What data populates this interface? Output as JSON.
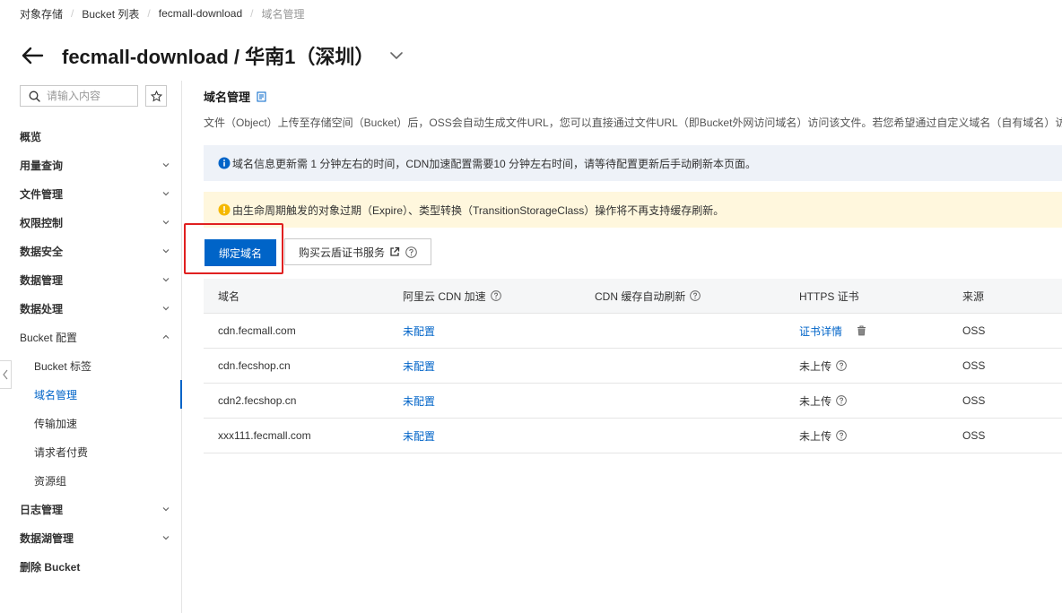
{
  "breadcrumb": [
    "对象存储",
    "Bucket 列表",
    "fecmall-download",
    "域名管理"
  ],
  "header": {
    "title": "fecmall-download / 华南1（深圳）"
  },
  "sidebar": {
    "search_placeholder": "请输入内容",
    "items": [
      {
        "label": "概览"
      },
      {
        "label": "用量查询"
      },
      {
        "label": "文件管理"
      },
      {
        "label": "权限控制"
      },
      {
        "label": "数据安全"
      },
      {
        "label": "数据管理"
      },
      {
        "label": "数据处理"
      },
      {
        "label": "Bucket 配置"
      },
      {
        "label": "Bucket 标签"
      },
      {
        "label": "域名管理"
      },
      {
        "label": "传输加速"
      },
      {
        "label": "请求者付费"
      },
      {
        "label": "资源组"
      },
      {
        "label": "日志管理"
      },
      {
        "label": "数据湖管理"
      },
      {
        "label": "删除 Bucket"
      }
    ]
  },
  "main": {
    "section_title": "域名管理",
    "description": "文件（Object）上传至存储空间（Bucket）后，OSS会自动生成文件URL，您可以直接通过文件URL（即Bucket外网访问域名）访问该文件。若您希望通过自定义域名（自有域名）访问",
    "info_notice": "域名信息更新需 1 分钟左右的时间，CDN加速配置需要10 分钟左右时间，请等待配置更新后手动刷新本页面。",
    "warn_notice": "由生命周期触发的对象过期（Expire）、类型转换（TransitionStorageClass）操作将不再支持缓存刷新。",
    "bind_button": "绑定域名",
    "buy_cert_button": "购买云盾证书服务",
    "table": {
      "headers": [
        "域名",
        "阿里云 CDN 加速",
        "CDN 缓存自动刷新",
        "HTTPS 证书",
        "来源"
      ],
      "rows": [
        {
          "domain": "cdn.fecmall.com",
          "cdn": "未配置",
          "refresh": "",
          "https": "证书详情",
          "source": "OSS"
        },
        {
          "domain": "cdn.fecshop.cn",
          "cdn": "未配置",
          "refresh": "",
          "https": "未上传",
          "source": "OSS"
        },
        {
          "domain": "cdn2.fecshop.cn",
          "cdn": "未配置",
          "refresh": "",
          "https": "未上传",
          "source": "OSS"
        },
        {
          "domain": "xxx111.fecmall.com",
          "cdn": "未配置",
          "refresh": "",
          "https": "未上传",
          "source": "OSS"
        }
      ]
    }
  },
  "colors": {
    "accent": "#0064c8",
    "highlight": "#e02020",
    "info_bg": "#eef2f8",
    "warn_bg": "#fff7dd",
    "warn_icon": "#f5b800"
  }
}
